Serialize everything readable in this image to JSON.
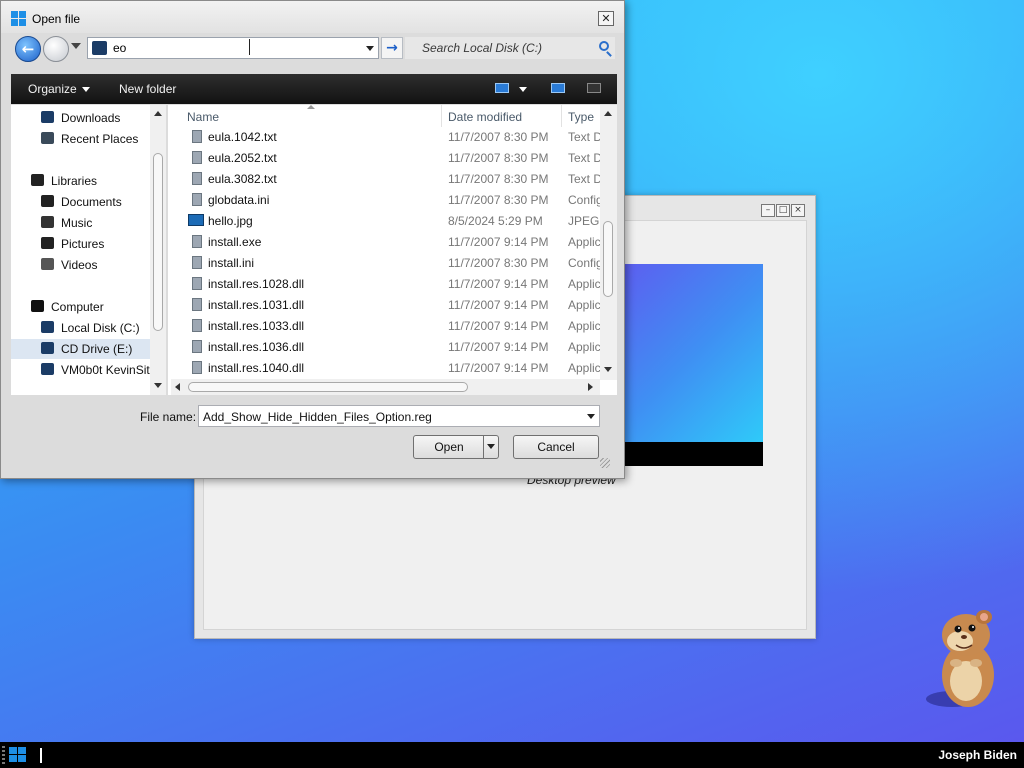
{
  "dialog": {
    "title": "Open file",
    "address_value": "eo",
    "search_placeholder": "Search Local Disk (C:)",
    "toolbar": {
      "organize": "Organize",
      "new_folder": "New folder"
    },
    "nav_items": [
      {
        "label": "Downloads",
        "icon": "downloads-icon"
      },
      {
        "label": "Recent Places",
        "icon": "recent-places-icon"
      },
      {
        "label": "Libraries",
        "icon": "libraries-icon"
      },
      {
        "label": "Documents",
        "icon": "documents-icon"
      },
      {
        "label": "Music",
        "icon": "music-icon"
      },
      {
        "label": "Pictures",
        "icon": "pictures-icon"
      },
      {
        "label": "Videos",
        "icon": "videos-icon"
      },
      {
        "label": "Computer",
        "icon": "computer-icon"
      },
      {
        "label": "Local Disk (C:)",
        "icon": "drive-icon"
      },
      {
        "label": "CD Drive (E:)",
        "icon": "cd-drive-icon"
      },
      {
        "label": "VM0b0t KevinSite",
        "icon": "network-drive-icon"
      }
    ],
    "columns": {
      "name": "Name",
      "date": "Date modified",
      "type": "Type"
    },
    "files": [
      {
        "name": "eula.1042.txt",
        "date": "11/7/2007 8:30 PM",
        "type": "Text D"
      },
      {
        "name": "eula.2052.txt",
        "date": "11/7/2007 8:30 PM",
        "type": "Text D"
      },
      {
        "name": "eula.3082.txt",
        "date": "11/7/2007 8:30 PM",
        "type": "Text D"
      },
      {
        "name": "globdata.ini",
        "date": "11/7/2007 8:30 PM",
        "type": "Config"
      },
      {
        "name": "hello.jpg",
        "date": "8/5/2024 5:29 PM",
        "type": "JPEG i"
      },
      {
        "name": "install.exe",
        "date": "11/7/2007 9:14 PM",
        "type": "Applic"
      },
      {
        "name": "install.ini",
        "date": "11/7/2007 8:30 PM",
        "type": "Config"
      },
      {
        "name": "install.res.1028.dll",
        "date": "11/7/2007 9:14 PM",
        "type": "Applic"
      },
      {
        "name": "install.res.1031.dll",
        "date": "11/7/2007 9:14 PM",
        "type": "Applic"
      },
      {
        "name": "install.res.1033.dll",
        "date": "11/7/2007 9:14 PM",
        "type": "Applic"
      },
      {
        "name": "install.res.1036.dll",
        "date": "11/7/2007 9:14 PM",
        "type": "Applic"
      },
      {
        "name": "install.res.1040.dll",
        "date": "11/7/2007 9:14 PM",
        "type": "Applic"
      }
    ],
    "file_name_label": "File name:",
    "file_name_value": "Add_Show_Hide_Hidden_Files_Option.reg",
    "open_label": "Open",
    "cancel_label": "Cancel"
  },
  "background_window": {
    "preview_caption": "Desktop preview"
  },
  "taskbar": {
    "user_name": "Joseph Biden"
  },
  "colors": {
    "accent": "#1d8fe6",
    "toolbar_bg": "#1a1a1a",
    "selection": "#dce6f2"
  }
}
